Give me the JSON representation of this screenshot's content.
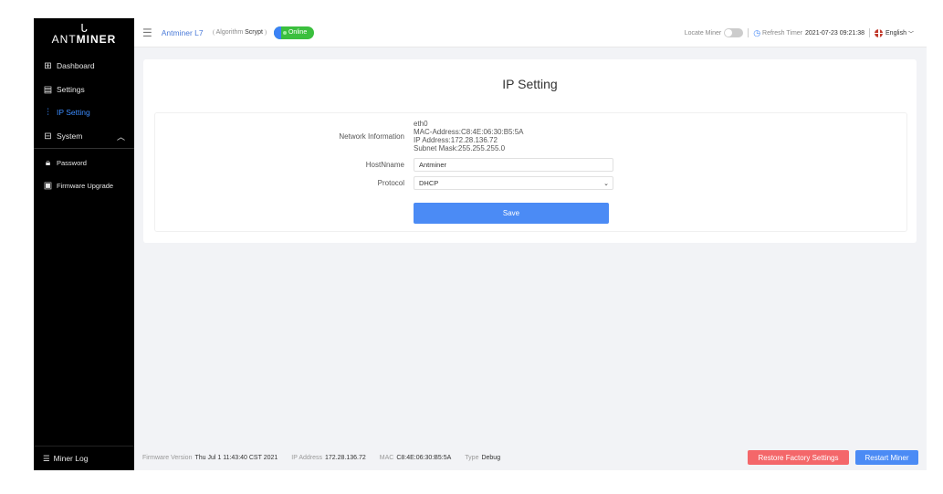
{
  "sidebar": {
    "logo": "ANTMINER",
    "logo_prefix": "ANT",
    "logo_suffix": "MINER",
    "items": [
      {
        "label": "Dashboard"
      },
      {
        "label": "Settings"
      },
      {
        "label": "IP Setting"
      },
      {
        "label": "System"
      },
      {
        "label": "Password"
      },
      {
        "label": "Firmware Upgrade"
      }
    ],
    "miner_log": "Miner Log"
  },
  "header": {
    "model": "Antminer L7",
    "algorithm_label": "Algorithm",
    "algorithm": "Scrypt",
    "status": "Online",
    "locate_miner": "Locate Miner",
    "refresh_label": "Refresh Timer",
    "refresh_time": "2021-07-23 09:21:38",
    "language": "English"
  },
  "page": {
    "title": "IP Setting",
    "network_label": "Network Information",
    "network": {
      "iface": "eth0",
      "mac": "MAC-Address:C8:4E:06:30:B5:5A",
      "ip": "IP Address:172.28.136.72",
      "mask": "Subnet Mask:255.255.255.0"
    },
    "hostname_label": "HostNname",
    "hostname": "Antminer",
    "protocol_label": "Protocol",
    "protocol": "DHCP",
    "save": "Save"
  },
  "footer": {
    "fw_label": "Firmware Version",
    "fw": "Thu Jul 1 11:43:40 CST 2021",
    "ip_label": "IP Address",
    "ip": "172.28.136.72",
    "mac_label": "MAC",
    "mac": "C8:4E:06:30:B5:5A",
    "type_label": "Type",
    "type": "Debug",
    "restore": "Restore Factory Settings",
    "restart": "Restart Miner"
  },
  "colors": {
    "accent": "#4b8bf5",
    "online": "#3bbf3e",
    "danger": "#f4676a"
  }
}
